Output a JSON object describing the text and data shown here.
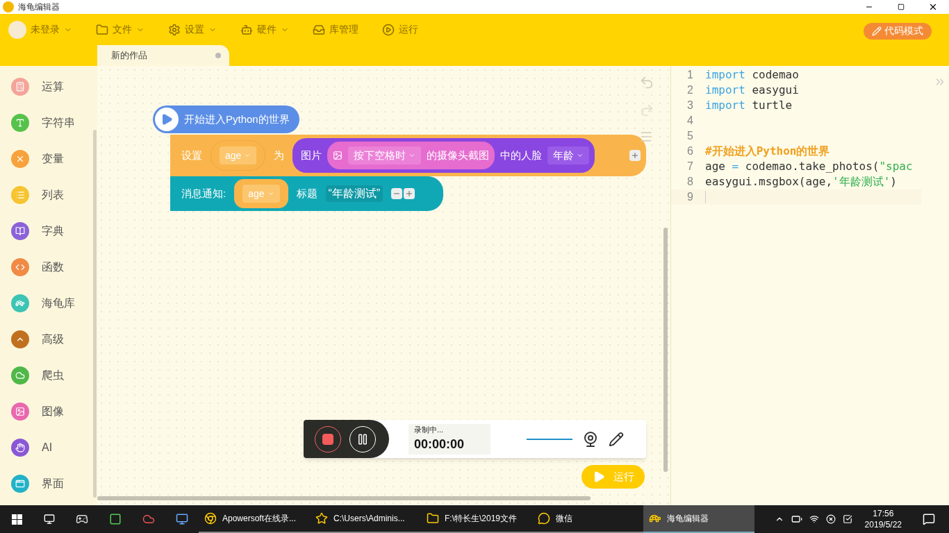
{
  "window": {
    "title": "海龟编辑器"
  },
  "menu": [
    {
      "label": "未登录",
      "dropdown": true
    },
    {
      "label": "文件",
      "dropdown": true
    },
    {
      "label": "设置",
      "dropdown": true
    },
    {
      "label": "硬件",
      "dropdown": true
    },
    {
      "label": "库管理",
      "dropdown": false
    },
    {
      "label": "运行",
      "dropdown": false
    }
  ],
  "mode_button": "代码模式",
  "tabs": [
    {
      "label": "新的作品",
      "selected": true
    }
  ],
  "sidebar": {
    "items": [
      {
        "label": "运算",
        "color": "#f4a49a"
      },
      {
        "label": "字符串",
        "color": "#56c24c"
      },
      {
        "label": "变量",
        "color": "#f7a23c"
      },
      {
        "label": "列表",
        "color": "#f5c430"
      },
      {
        "label": "字典",
        "color": "#8c62d8"
      },
      {
        "label": "函数",
        "color": "#f08a45"
      },
      {
        "label": "海龟库",
        "color": "#3cc4b4"
      },
      {
        "label": "高级",
        "color": "#c0701f"
      },
      {
        "label": "爬虫",
        "color": "#4fb848"
      },
      {
        "label": "图像",
        "color": "#e968ae"
      },
      {
        "label": "AI",
        "color": "#8a58d6"
      },
      {
        "label": "界面",
        "color": "#22b2c8"
      }
    ]
  },
  "blocks": {
    "hat": "开始进入Python的世界",
    "set_block": {
      "label": "设置",
      "variable": "age",
      "word": "为",
      "picture_label": "图片",
      "trigger": "按下空格时",
      "capture_label": "的摄像头截图",
      "face_label": "中的人脸",
      "attribute": "年龄"
    },
    "message_block": {
      "label": "消息通知:",
      "variable": "age",
      "title_label": "标题",
      "title_value": "“年龄测试”"
    }
  },
  "code": {
    "lines": [
      {
        "number": "1",
        "current": false,
        "segments": [
          {
            "text": "import",
            "kind": "keyword"
          },
          {
            "text": " codemao",
            "kind": "plain"
          }
        ]
      },
      {
        "number": "2",
        "current": false,
        "segments": [
          {
            "text": "import",
            "kind": "keyword"
          },
          {
            "text": " easygui",
            "kind": "plain"
          }
        ]
      },
      {
        "number": "3",
        "current": false,
        "segments": [
          {
            "text": "import",
            "kind": "keyword"
          },
          {
            "text": " turtle",
            "kind": "plain"
          }
        ]
      },
      {
        "number": "4",
        "current": false
      },
      {
        "number": "5",
        "current": false
      },
      {
        "number": "6",
        "current": false,
        "segments": [
          {
            "text": "#开始进入Python的世界",
            "kind": "comment"
          }
        ]
      },
      {
        "number": "7",
        "current": false,
        "segments": [
          {
            "text": "age ",
            "kind": "plain"
          },
          {
            "text": "=",
            "kind": "operator"
          },
          {
            "text": " codemao.take_photos(",
            "kind": "plain"
          },
          {
            "text": "\"spac",
            "kind": "string"
          }
        ]
      },
      {
        "number": "8",
        "current": false,
        "segments": [
          {
            "text": "easygui.msgbox(age,",
            "kind": "plain"
          },
          {
            "text": "'年龄测试'",
            "kind": "string"
          },
          {
            "text": ")",
            "kind": "plain"
          }
        ]
      },
      {
        "number": "9",
        "current": true
      }
    ]
  },
  "recorder": {
    "status": "录制中...",
    "time": "00:00:00"
  },
  "run_button": "运行",
  "taskbar": {
    "windows": [
      {
        "label": "Apowersoft在线录...",
        "selected": false
      },
      {
        "label": "C:\\Users\\Adminis...",
        "selected": false
      },
      {
        "label": "F:\\特长生\\2019文件",
        "selected": false
      },
      {
        "label": "微信",
        "selected": false
      },
      {
        "label": "海龟编辑器",
        "selected": true
      }
    ],
    "time": "17:56",
    "date": "2019/5/22"
  }
}
